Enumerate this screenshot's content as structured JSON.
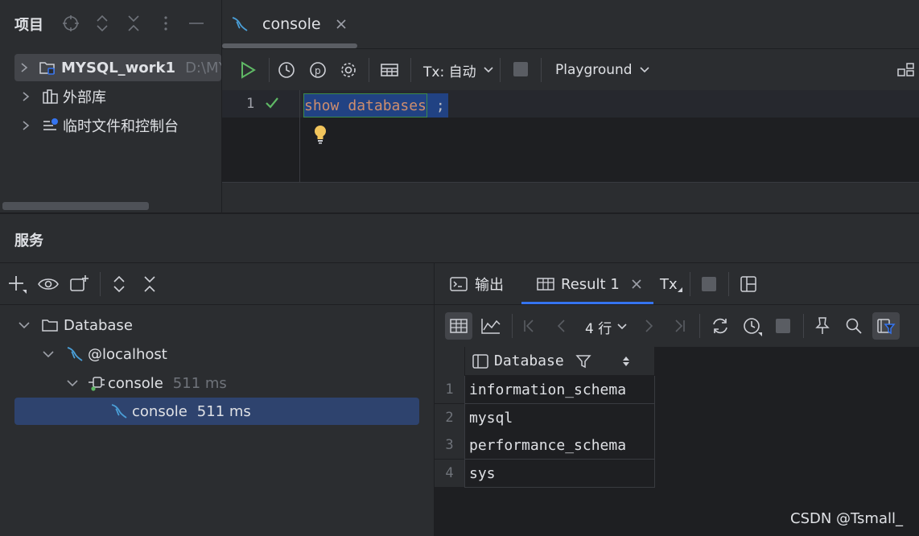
{
  "project": {
    "title": "项目",
    "items": [
      {
        "label": "MYSQL_work1",
        "path": "D:\\MY"
      },
      {
        "label": "外部库"
      },
      {
        "label": "临时文件和控制台"
      }
    ]
  },
  "editor": {
    "tab_label": "console",
    "toolbar": {
      "tx_label": "Tx: 自动",
      "playground_label": "Playground"
    },
    "line_number": "1",
    "code_keyword1": "show",
    "code_keyword2": "databases",
    "code_semicolon": ";"
  },
  "services": {
    "title": "服务",
    "tree": [
      {
        "label": "Database"
      },
      {
        "label": "@localhost"
      },
      {
        "label": "console",
        "time": "511 ms"
      },
      {
        "label": "console",
        "time": "511 ms"
      }
    ]
  },
  "results": {
    "tabs": {
      "output_label": "输出",
      "result_label": "Result 1",
      "tx_label": "Tx"
    },
    "rows_label": "4 行",
    "column_header": "Database",
    "rows": [
      {
        "num": "1",
        "value": "information_schema"
      },
      {
        "num": "2",
        "value": "mysql"
      },
      {
        "num": "3",
        "value": "performance_schema"
      },
      {
        "num": "4",
        "value": "sys"
      }
    ]
  },
  "watermark": "CSDN @Tsmall_",
  "colors": {
    "accent_blue": "#3574f0",
    "selection": "#2e436e",
    "run_green": "#5fb865",
    "keyword": "#cf8e6d",
    "mysql_blue": "#4a9fd8"
  }
}
